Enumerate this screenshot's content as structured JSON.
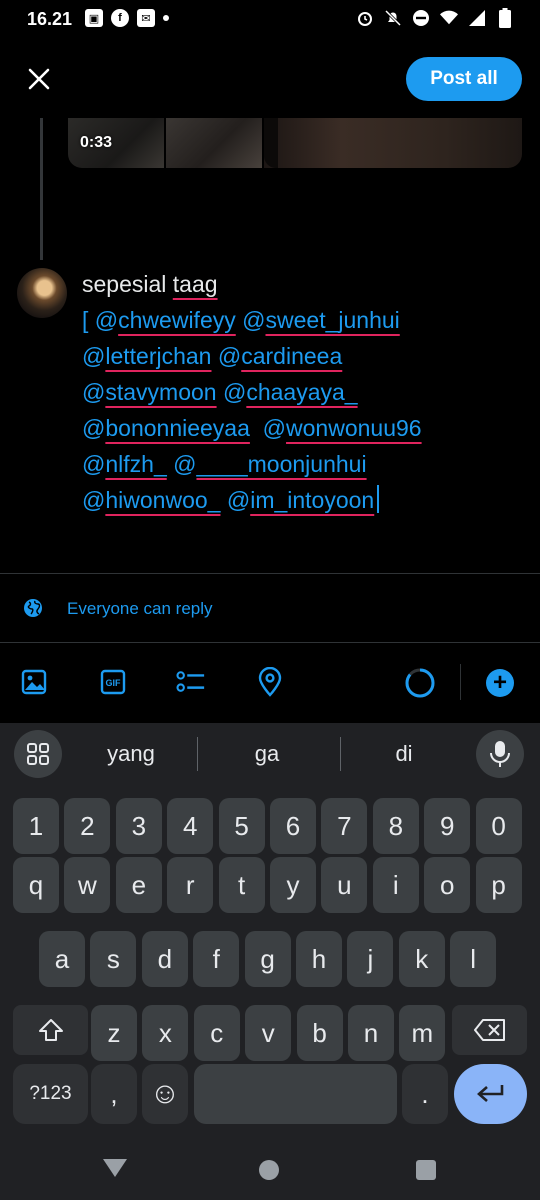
{
  "status_bar": {
    "time": "16.21",
    "left_icons": [
      "notification-app-icon",
      "facebook-icon",
      "mail-icon",
      "more-dot-icon"
    ],
    "right_icons": [
      "alarm-icon",
      "notifications-off-icon",
      "do-not-disturb-icon",
      "wifi-icon",
      "cellular-icon",
      "battery-icon"
    ]
  },
  "header": {
    "close_icon": "close-icon",
    "post_all_label": "Post all"
  },
  "previous_post": {
    "video_duration": "0:33"
  },
  "compose": {
    "first_line": "sepesial taag",
    "lines": [
      [
        {
          "t": "[ ",
          "m": false
        },
        {
          "t": "@chwewifeyy",
          "m": true
        },
        {
          "t": " ",
          "m": false
        },
        {
          "t": "@sweet_junhui",
          "m": true
        }
      ],
      [
        {
          "t": "@letterjchan",
          "m": true
        },
        {
          "t": " ",
          "m": false
        },
        {
          "t": "@cardineea",
          "m": true
        }
      ],
      [
        {
          "t": "@stavymoon",
          "m": true
        },
        {
          "t": " ",
          "m": false
        },
        {
          "t": "@chaayaya_",
          "m": true
        }
      ],
      [
        {
          "t": "@bononnieeyaa",
          "m": true
        },
        {
          "t": "  ",
          "m": false
        },
        {
          "t": "@wonwonuu96",
          "m": true
        }
      ],
      [
        {
          "t": "@nlfzh_",
          "m": true
        },
        {
          "t": " ",
          "m": false
        },
        {
          "t": "@____moonjunhui",
          "m": true
        }
      ],
      [
        {
          "t": "@hiwonwoo_",
          "m": true
        },
        {
          "t": " ",
          "m": false
        },
        {
          "t": "@im_intoyoon",
          "m": true
        }
      ]
    ]
  },
  "reply_setting": {
    "icon": "globe-icon",
    "label": "Everyone can reply"
  },
  "toolbar": {
    "items": [
      "image-icon",
      "gif-icon",
      "poll-icon",
      "location-icon"
    ],
    "gif_label": "GIF",
    "add_label": "+"
  },
  "keyboard": {
    "suggestions": [
      "yang",
      "ga",
      "di"
    ],
    "rows": [
      [
        "1",
        "2",
        "3",
        "4",
        "5",
        "6",
        "7",
        "8",
        "9",
        "0"
      ],
      [
        "q",
        "w",
        "e",
        "r",
        "t",
        "y",
        "u",
        "i",
        "o",
        "p"
      ],
      [
        "a",
        "s",
        "d",
        "f",
        "g",
        "h",
        "j",
        "k",
        "l"
      ],
      [
        "z",
        "x",
        "c",
        "v",
        "b",
        "n",
        "m"
      ]
    ],
    "symbols_label": "?123",
    "comma_label": ",",
    "period_label": ".",
    "emoji_label": "☺"
  },
  "colors": {
    "accent": "#1d9bf0",
    "spellcheck": "#e0245e",
    "key": "#3c4043",
    "keyboard_bg": "#202124",
    "enter": "#8ab4f8"
  }
}
